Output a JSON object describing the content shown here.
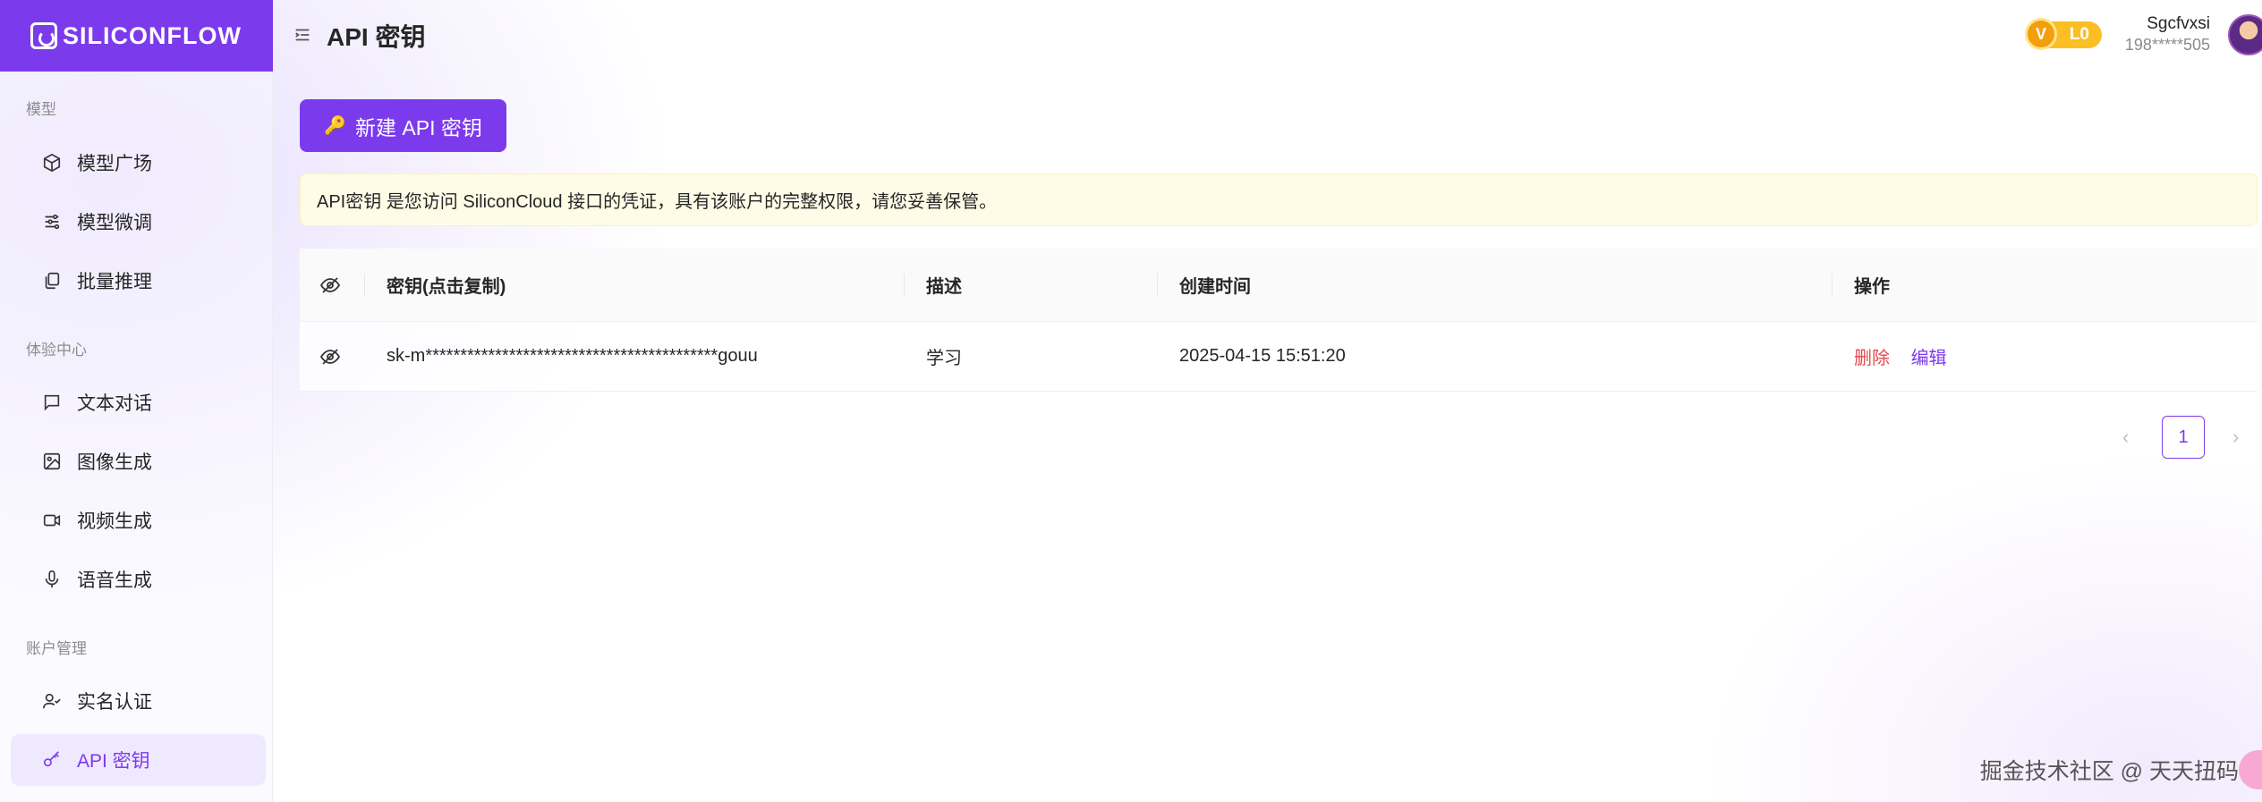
{
  "brand": {
    "name": "SILICONFLOW",
    "accent": "#7c3aed"
  },
  "header": {
    "title": "API 密钥",
    "level": {
      "badge": "V",
      "label": "L0"
    },
    "user": {
      "name": "Sgcfvxsi",
      "phone": "198*****505"
    }
  },
  "sidebar": {
    "sections": [
      {
        "label": "模型"
      },
      {
        "label": "体验中心"
      },
      {
        "label": "账户管理"
      }
    ],
    "items": [
      {
        "label": "模型广场",
        "icon": "cube-icon"
      },
      {
        "label": "模型微调",
        "icon": "sliders-icon"
      },
      {
        "label": "批量推理",
        "icon": "copy-icon"
      },
      {
        "label": "文本对话",
        "icon": "chat-icon"
      },
      {
        "label": "图像生成",
        "icon": "image-icon"
      },
      {
        "label": "视频生成",
        "icon": "video-icon"
      },
      {
        "label": "语音生成",
        "icon": "mic-icon"
      },
      {
        "label": "实名认证",
        "icon": "user-check-icon"
      },
      {
        "label": "API 密钥",
        "icon": "key-icon",
        "active": true
      }
    ]
  },
  "main": {
    "new_key_button": "新建 API 密钥",
    "notice": "API密钥 是您访问 SiliconCloud 接口的凭证，具有该账户的完整权限，请您妥善保管。",
    "table": {
      "columns": [
        "密钥(点击复制)",
        "描述",
        "创建时间",
        "操作"
      ],
      "rows": [
        {
          "key": "sk-m******************************************gouu",
          "description": "学习",
          "created": "2025-04-15 15:51:20",
          "actions": {
            "delete": "删除",
            "edit": "编辑"
          }
        }
      ]
    },
    "pagination": {
      "current": "1",
      "prev": "‹",
      "next": "›"
    }
  },
  "watermark": "掘金技术社区 @ 天天扭码"
}
